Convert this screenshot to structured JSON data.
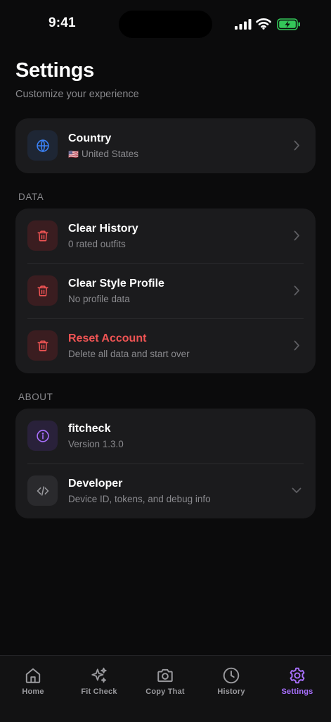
{
  "status": {
    "time": "9:41"
  },
  "header": {
    "title": "Settings",
    "subtitle": "Customize your experience"
  },
  "country": {
    "label": "Country",
    "flag": "🇺🇸",
    "value": "United States"
  },
  "data_section": {
    "label": "DATA",
    "items": [
      {
        "label": "Clear History",
        "sub": "0 rated outfits"
      },
      {
        "label": "Clear Style Profile",
        "sub": "No profile data"
      },
      {
        "label": "Reset Account",
        "sub": "Delete all data and start over"
      }
    ]
  },
  "about_section": {
    "label": "ABOUT",
    "items": [
      {
        "label": "fitcheck",
        "sub": "Version 1.3.0"
      },
      {
        "label": "Developer",
        "sub": "Device ID, tokens, and debug info"
      }
    ]
  },
  "tabs": [
    {
      "label": "Home",
      "icon": "home-icon"
    },
    {
      "label": "Fit Check",
      "icon": "sparkles-icon"
    },
    {
      "label": "Copy That",
      "icon": "camera-icon"
    },
    {
      "label": "History",
      "icon": "clock-icon"
    },
    {
      "label": "Settings",
      "icon": "gear-icon",
      "active": true
    }
  ],
  "colors": {
    "background": "#0b0b0c",
    "card": "#1b1b1d",
    "accent": "#a970ff",
    "danger": "#f05454",
    "globe": "#3b82f6",
    "battery": "#34c759"
  }
}
